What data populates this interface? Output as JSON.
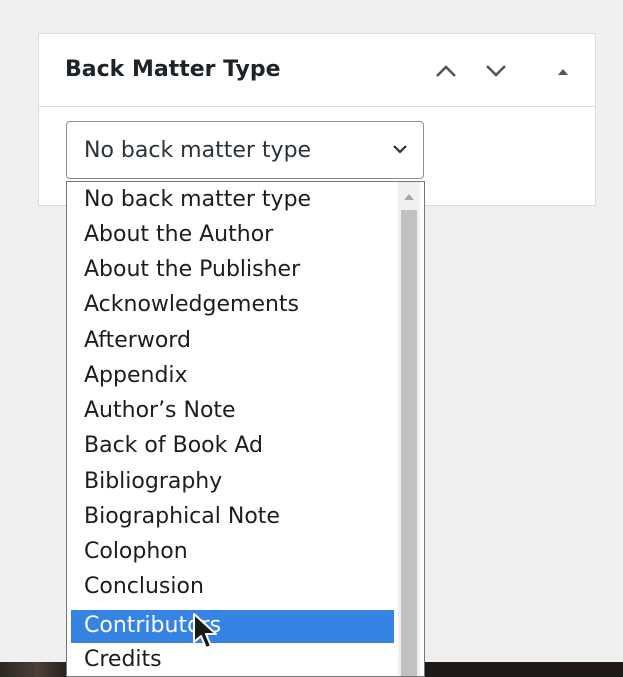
{
  "metabox": {
    "title": "Back Matter Type",
    "icons": {
      "move_up": "chevron-up-icon",
      "move_down": "chevron-down-icon",
      "toggle": "triangle-up-icon"
    }
  },
  "select": {
    "current_value": "No back matter type",
    "icon": "chevron-down-icon"
  },
  "dropdown": {
    "options": [
      "No back matter type",
      "About the Author",
      "About the Publisher",
      "Acknowledgements",
      "Afterword",
      "Appendix",
      "Author’s Note",
      "Back of Book Ad",
      "Bibliography",
      "Biographical Note",
      "Colophon",
      "Conclusion",
      "Contributors",
      "Credits"
    ],
    "highlighted_option": "Contributors"
  },
  "colors": {
    "highlight": "#3584e4",
    "page_background": "#f0f0f1",
    "panel_border": "#dcdcde",
    "text": "#1d2327"
  }
}
